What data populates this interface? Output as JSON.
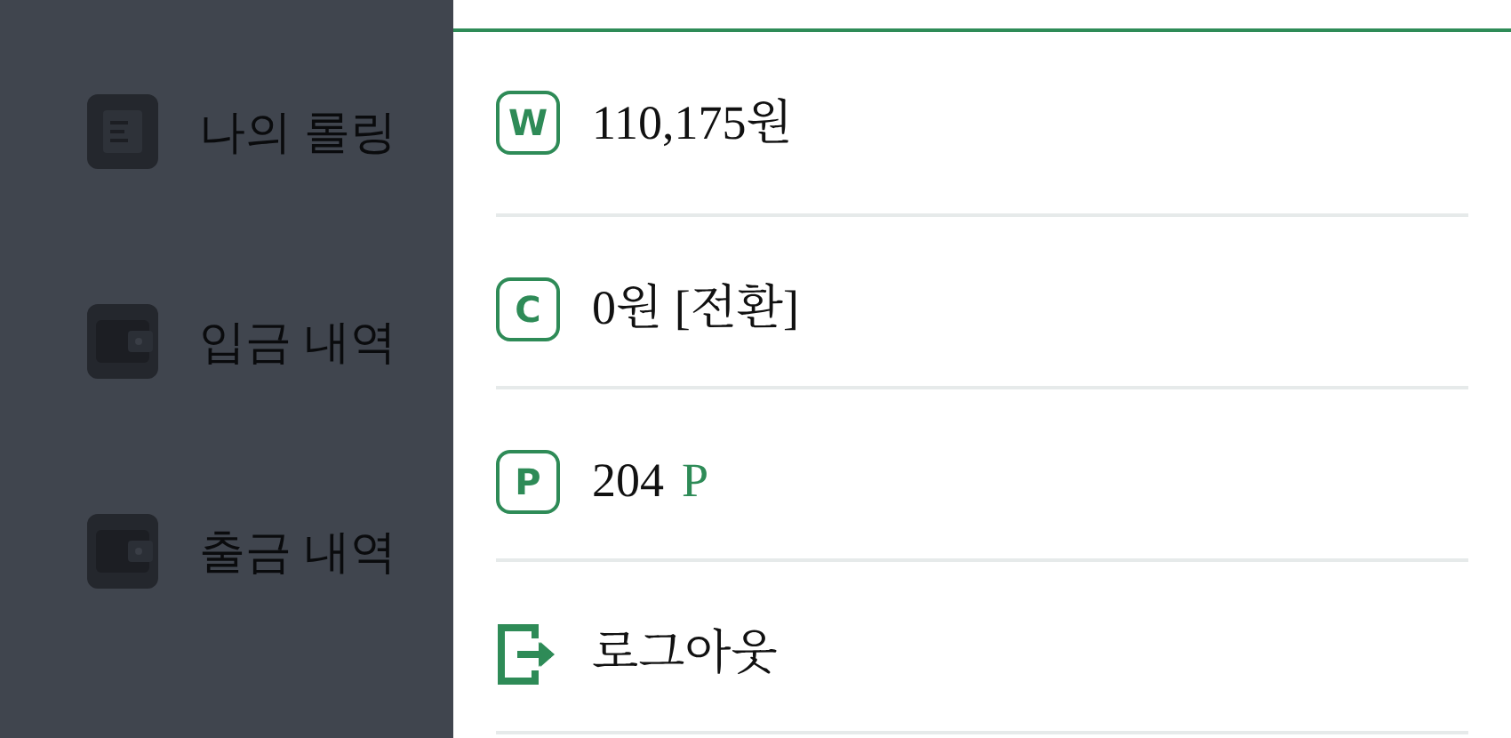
{
  "sidebar": {
    "dimmed": true,
    "items": [
      {
        "label": "나의 롤링",
        "kind": "document"
      },
      {
        "label": "입금 내역",
        "kind": "wallet"
      },
      {
        "label": "출금 내역",
        "kind": "wallet"
      }
    ]
  },
  "drawer": {
    "items": [
      {
        "kind": "badge",
        "badge": "W",
        "value": "110,175원"
      },
      {
        "kind": "badge",
        "badge": "C",
        "value": "0원 [전환]"
      },
      {
        "kind": "badge",
        "badge": "P",
        "value": "204",
        "unit": "P"
      },
      {
        "kind": "logout",
        "value": "로그아웃"
      }
    ]
  }
}
